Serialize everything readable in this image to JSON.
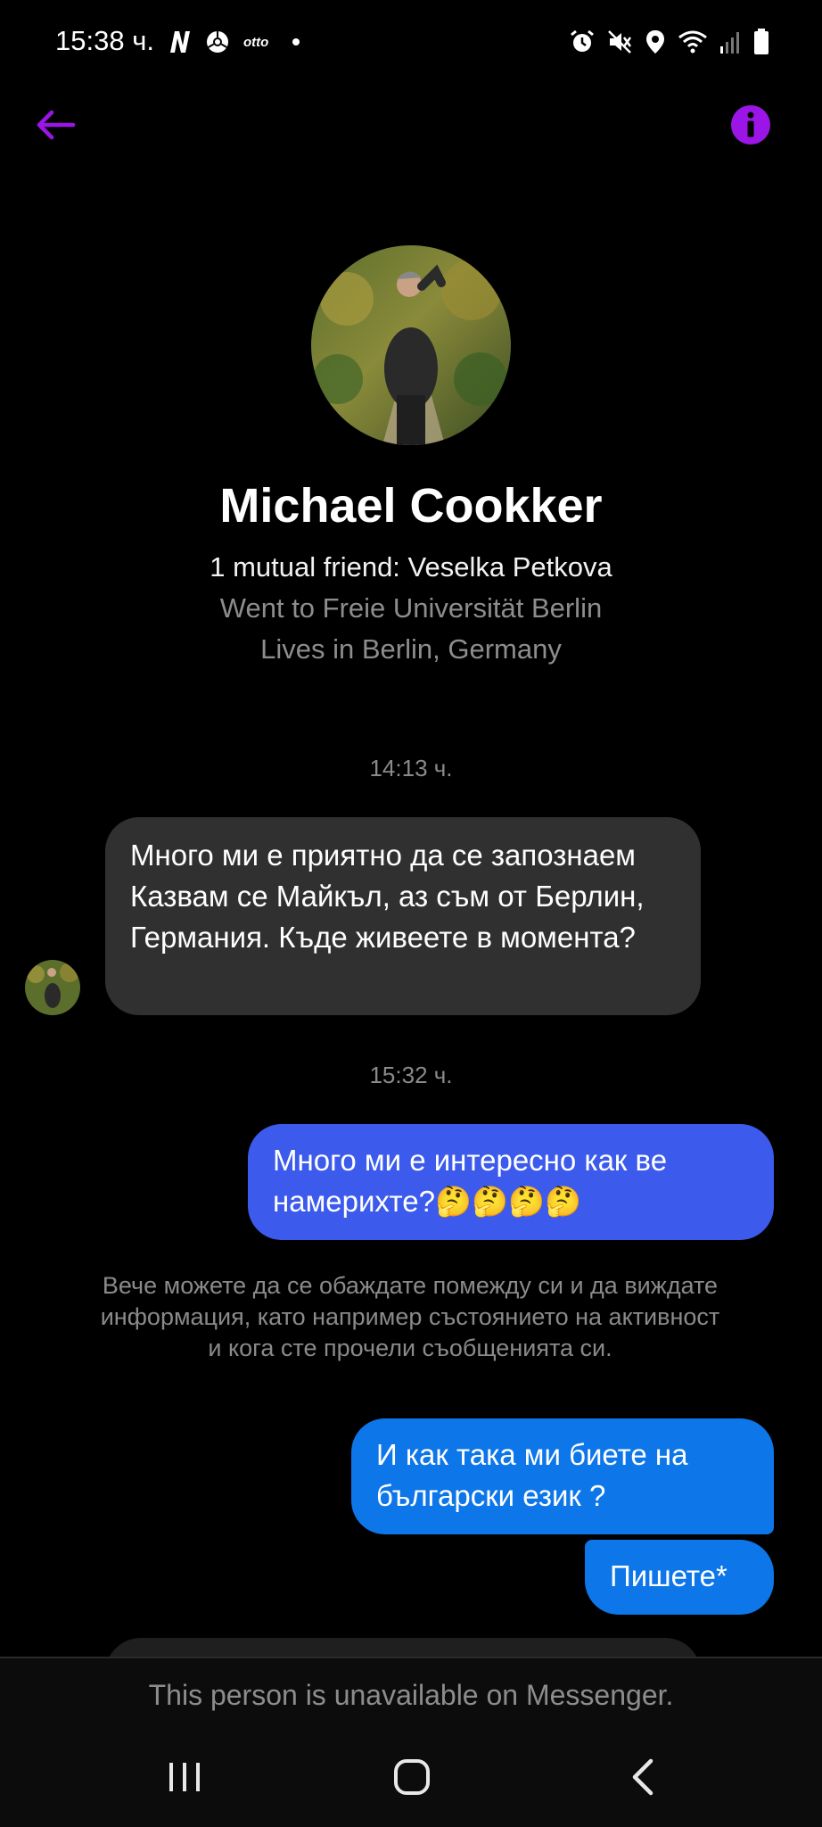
{
  "status_bar": {
    "time": "15:38 ч.",
    "left_icons": [
      "netflix-n-icon",
      "chrome-icon",
      "otto-icon",
      "dot-icon"
    ],
    "right_icons": [
      "alarm-icon",
      "mute-icon",
      "location-icon",
      "wifi-icon",
      "signal-icon",
      "battery-icon"
    ],
    "left_label_otto": "otto"
  },
  "header": {
    "back_icon": "back-arrow-icon",
    "info_icon": "info-icon",
    "accent_color": "#9b16e6"
  },
  "profile": {
    "name": "Michael Cookker",
    "mutual": "1 mutual friend: Veselka Petkova",
    "school": "Went to Freie Universität Berlin",
    "lives": "Lives in Berlin, Germany"
  },
  "messages": {
    "timestamp_1": "14:13 ч.",
    "incoming_1": "Много ми е приятно да се запознаем Казвам се Майкъл, аз съм от Берлин, Германия. Къде живеете в момента?",
    "timestamp_2": "15:32 ч.",
    "outgoing_1_text": "Много ми е интересно как ве намерихте?",
    "outgoing_1_emojis": "🤔🤔🤔🤔",
    "system_notice": "Вече можете да се обаждате помежду си и да виждате информация, като например състоянието на активност и кога сте прочели съобщенията си.",
    "outgoing_2": "И как така ми биете на български език ?",
    "outgoing_3": "Пишете*"
  },
  "footer": {
    "unavailable_text": "This person is unavailable on Messenger."
  },
  "nav_bar": {
    "icons": [
      "recent-apps-icon",
      "home-icon",
      "back-icon"
    ]
  }
}
